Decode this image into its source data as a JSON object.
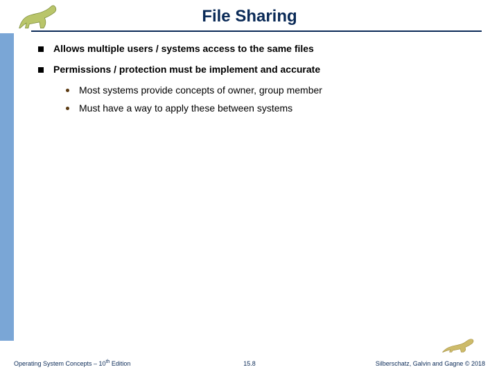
{
  "header": {
    "title": "File Sharing"
  },
  "bullets": {
    "b1": "Allows multiple users / systems access to the same files",
    "b2": "Permissions / protection must be implement and accurate",
    "s1": "Most systems provide concepts of owner, group member",
    "s2": "Must have a way to apply these between systems"
  },
  "footer": {
    "left_a": "Operating System Concepts – 10",
    "left_sup": "th",
    "left_b": " Edition",
    "center": "15.8",
    "right": "Silberschatz, Galvin and Gagne © 2018"
  }
}
